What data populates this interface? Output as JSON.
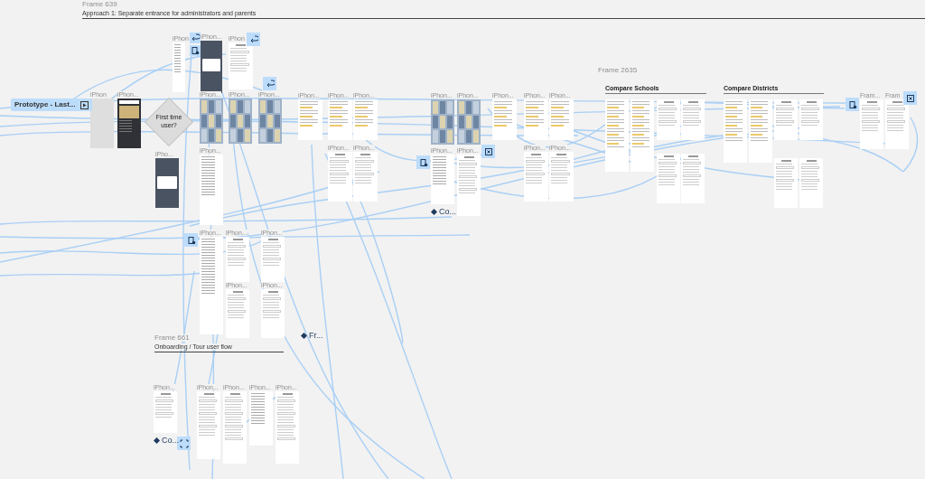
{
  "frames": [
    {
      "kind": "header",
      "title": "Frame 639",
      "subtitle": "Approach 1: Separate entrance for administrators and parents"
    },
    {
      "kind": "plain",
      "title": "Frame 2635"
    },
    {
      "kind": "section",
      "title": "Compare Schools"
    },
    {
      "kind": "section",
      "title": "Compare Districts"
    },
    {
      "kind": "header",
      "title": "Frame 661",
      "subtitle": "Onboarding / Tour user flow"
    }
  ],
  "prototype_badge": {
    "label": "Prototype - Last..."
  },
  "decision": {
    "label": "First time user?"
  },
  "components": [
    {
      "label": "Co..."
    },
    {
      "label": "Co..."
    },
    {
      "label": "Fr..."
    }
  ],
  "phones": [
    {
      "label": "iPhon",
      "kind": "list"
    },
    {
      "label": "iPhon...",
      "kind": "dark"
    },
    {
      "label": "iPhon",
      "kind": "form"
    },
    {
      "label": "iPhon",
      "kind": "blank"
    },
    {
      "label": "iPhon...",
      "kind": "photo"
    },
    {
      "label": "iPhon...",
      "kind": "map"
    },
    {
      "label": "iPhon...",
      "kind": "map"
    },
    {
      "label": "iPhon...",
      "kind": "map"
    },
    {
      "label": "iPhon...",
      "kind": "table"
    },
    {
      "label": "iPhon...",
      "kind": "table"
    },
    {
      "label": "iPhon...",
      "kind": "table"
    },
    {
      "label": "iPhon...",
      "kind": "map"
    },
    {
      "label": "iPhon...",
      "kind": "map"
    },
    {
      "label": "iPhon...",
      "kind": "table"
    },
    {
      "label": "iPhon...",
      "kind": "table"
    },
    {
      "label": "iPhon...",
      "kind": "table"
    },
    {
      "label": "iPho...",
      "kind": "dark"
    },
    {
      "label": "iPhon...",
      "kind": "list"
    },
    {
      "label": "iPhon...",
      "kind": "form"
    },
    {
      "label": "iPhon...",
      "kind": "form"
    },
    {
      "label": "iPhon...",
      "kind": "list"
    },
    {
      "label": "iPhon...",
      "kind": "form"
    },
    {
      "label": "iPhon...",
      "kind": "form"
    },
    {
      "label": "iPhon...",
      "kind": "form"
    },
    {
      "label": "iPhon...",
      "kind": "list"
    },
    {
      "label": "iPhon...",
      "kind": "form"
    },
    {
      "label": "iPhon...",
      "kind": "form"
    },
    {
      "label": "iPhon...",
      "kind": "form"
    },
    {
      "label": "iPhon...",
      "kind": "form"
    },
    {
      "kind": "table"
    },
    {
      "kind": "table"
    },
    {
      "kind": "form"
    },
    {
      "kind": "form"
    },
    {
      "kind": "form"
    },
    {
      "kind": "form"
    },
    {
      "kind": "table"
    },
    {
      "kind": "table"
    },
    {
      "kind": "form"
    },
    {
      "kind": "form"
    },
    {
      "kind": "form"
    },
    {
      "kind": "form"
    },
    {
      "label": "Fram...",
      "kind": "form"
    },
    {
      "label": "Fram",
      "kind": "form"
    },
    {
      "label": "iPhon...",
      "kind": "form"
    },
    {
      "label": "iPhon...",
      "kind": "form"
    },
    {
      "label": "iPhon...",
      "kind": "form"
    },
    {
      "label": "iPhon...",
      "kind": "list"
    },
    {
      "label": "iPhon...",
      "kind": "form"
    }
  ]
}
